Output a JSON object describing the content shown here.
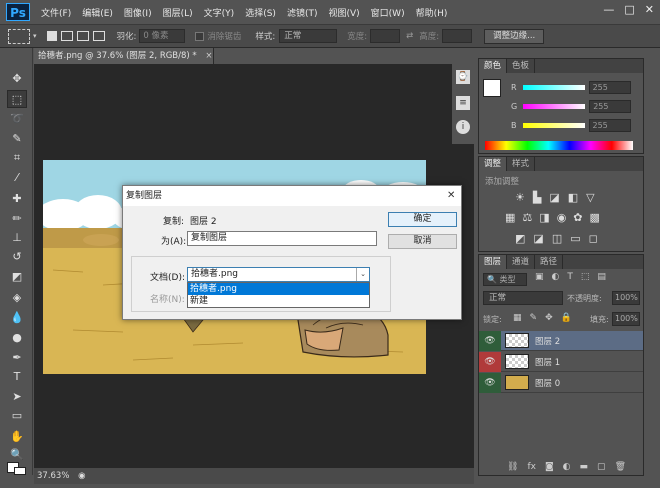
{
  "app": {
    "logo": "Ps",
    "menus": [
      "文件(F)",
      "编辑(E)",
      "图像(I)",
      "图层(L)",
      "文字(Y)",
      "选择(S)",
      "滤镜(T)",
      "视图(V)",
      "窗口(W)",
      "帮助(H)"
    ],
    "window_controls": [
      "—",
      "□",
      "✕"
    ]
  },
  "options_bar": {
    "feather_label": "羽化:",
    "feather_value": "0 像素",
    "antialias_label": "消除锯齿",
    "style_label": "样式:",
    "style_value": "正常",
    "width_label": "宽度:",
    "height_label": "高度:",
    "refine_button": "调整边缘..."
  },
  "document": {
    "tab_title": "拾穗者.png @ 37.6% (图层 2, RGB/8) *",
    "tab_close": "×",
    "zoom": "37.63%"
  },
  "color_panel": {
    "tabs": [
      "颜色",
      "色板"
    ],
    "channels": [
      {
        "label": "R",
        "value": "255"
      },
      {
        "label": "G",
        "value": "255"
      },
      {
        "label": "B",
        "value": "255"
      }
    ]
  },
  "adjust_panel": {
    "tabs": [
      "调整",
      "样式"
    ],
    "title": "添加调整"
  },
  "layers_panel": {
    "tabs": [
      "图层",
      "通道",
      "路径"
    ],
    "filter_label": "类型",
    "blend_mode": "正常",
    "opacity_label": "不透明度:",
    "opacity_value": "100%",
    "lock_label": "锁定:",
    "fill_label": "填充:",
    "fill_value": "100%",
    "layers": [
      {
        "name": "图层 2",
        "selected": true
      },
      {
        "name": "图层 1",
        "selected": false
      },
      {
        "name": "图层 0",
        "selected": false
      }
    ]
  },
  "dialog": {
    "title": "复制图层",
    "close": "✕",
    "copy_label": "复制:",
    "copy_value": "图层 2",
    "as_label": "为(A):",
    "as_value": "复制图层",
    "ok_button": "确定",
    "cancel_button": "取消",
    "doc_label": "文档(D):",
    "doc_value": "拾穗者.png",
    "name_label": "名称(N):",
    "dropdown_options": [
      "拾穗者.png",
      "新建"
    ]
  },
  "colors": {
    "accent": "#0078d7",
    "selected_layer": "#5c6c85"
  }
}
